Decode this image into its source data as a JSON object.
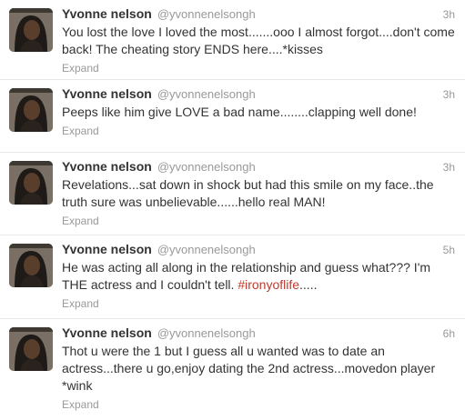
{
  "tweets": [
    {
      "fullname": "Yvonne nelson",
      "username": "@yvonnenelsongh",
      "time": "3h",
      "text": "You lost the love I loved the most.......ooo I almost forgot....don't come back! The cheating story ENDS here....*kisses",
      "hashtag": "",
      "text_after": "",
      "expand": "Expand"
    },
    {
      "fullname": "Yvonne nelson",
      "username": "@yvonnenelsongh",
      "time": "3h",
      "text": "Peeps like him give LOVE a bad name........clapping well done!",
      "hashtag": "",
      "text_after": "",
      "expand": "Expand"
    },
    {
      "fullname": "Yvonne nelson",
      "username": "@yvonnenelsongh",
      "time": "3h",
      "text": "Revelations...sat down in shock but had this smile on my face..the truth sure was unbelievable......hello real MAN!",
      "hashtag": "",
      "text_after": "",
      "expand": "Expand"
    },
    {
      "fullname": "Yvonne nelson",
      "username": "@yvonnenelsongh",
      "time": "5h",
      "text": "He was acting all along in the relationship and guess what??? I'm THE actress and I couldn't tell. ",
      "hashtag": "#ironyoflife",
      "text_after": ".....",
      "expand": "Expand"
    },
    {
      "fullname": "Yvonne nelson",
      "username": "@yvonnenelsongh",
      "time": "6h",
      "text": "Thot u were the 1 but I guess all u wanted was to date an actress...there u go,enjoy dating the 2nd actress...movedon player *wink",
      "hashtag": "",
      "text_after": "",
      "expand": "Expand"
    }
  ],
  "colors": {
    "name": "#333333",
    "meta": "#999999",
    "hashtag": "#c0392b",
    "divider": "#e8e8e8"
  }
}
